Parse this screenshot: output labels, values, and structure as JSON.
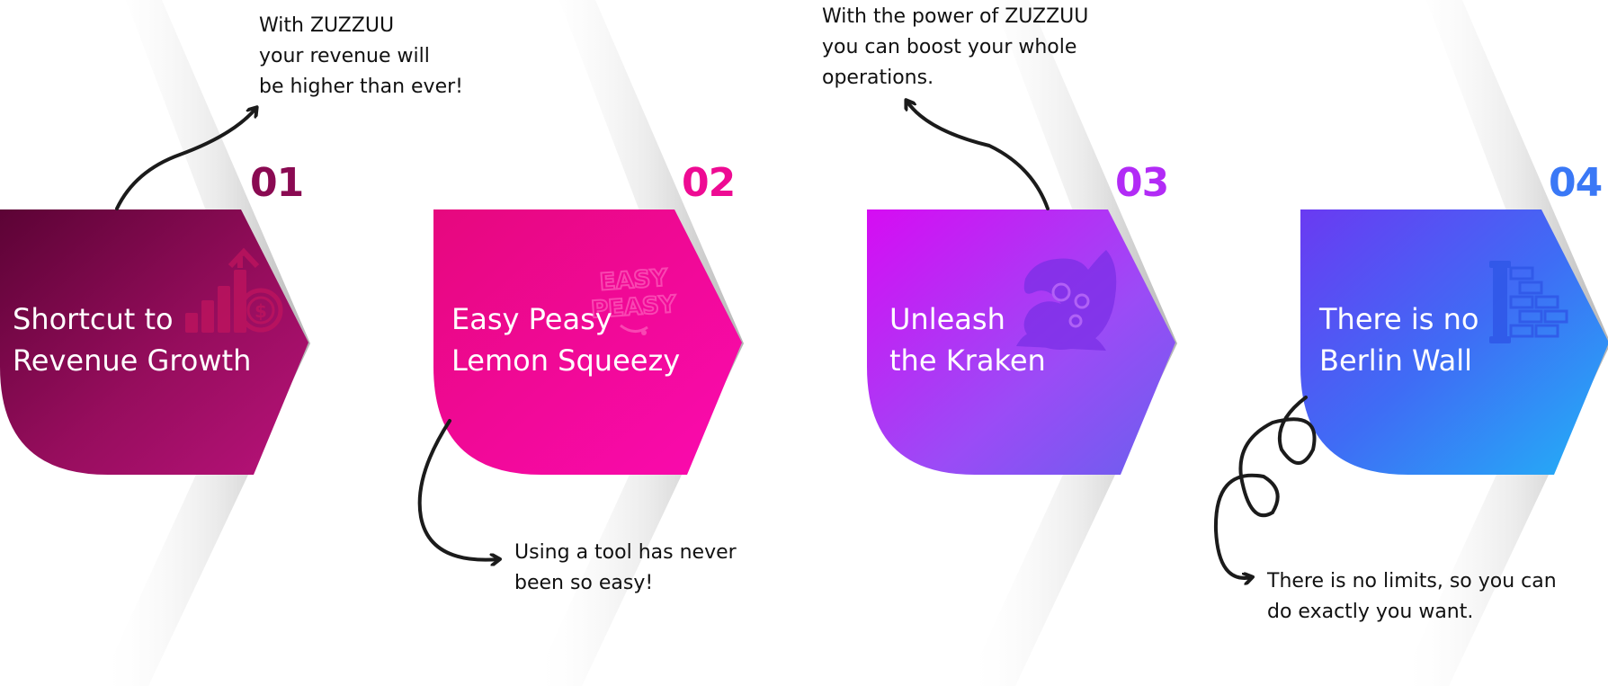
{
  "colors": {
    "step1_number": "#8a0a52",
    "step2_number": "#ee0b93",
    "step3_number": "#b22bf6",
    "step4_number": "#3a78f6",
    "arrow": "#1b1b1b"
  },
  "steps": [
    {
      "number": "01",
      "title": "Shortcut to\nRevenue Growth",
      "icon": "revenue-growth-icon",
      "note": "With ZUZZUU\nyour revenue will\nbe higher than ever!"
    },
    {
      "number": "02",
      "title": "Easy Peasy\nLemon Squeezy",
      "icon": "easy-peasy-icon",
      "note": "Using a tool has never\nbeen so easy!"
    },
    {
      "number": "03",
      "title": "Unleash\nthe Kraken",
      "icon": "kraken-icon",
      "note": "With the power of ZUZZUU\nyou can boost your whole\noperations."
    },
    {
      "number": "04",
      "title": "There is no\nBerlin Wall",
      "icon": "brick-wall-icon",
      "note": "There is no limits, so you can\ndo exactly you want."
    }
  ],
  "icon_text": {
    "easy_peasy": [
      "EASY",
      "PEASY"
    ]
  }
}
